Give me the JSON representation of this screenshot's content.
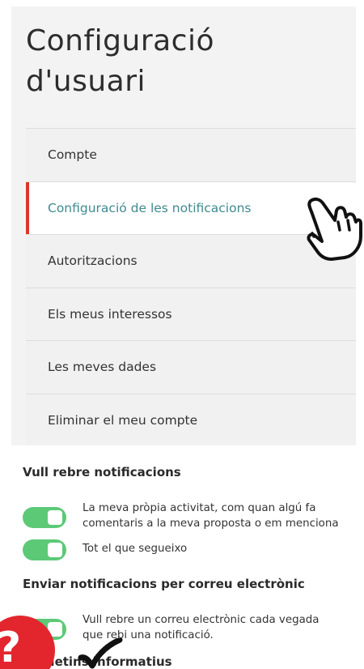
{
  "page": {
    "title": "Configuració d'usuari"
  },
  "menu": {
    "items": [
      {
        "label": "Compte"
      },
      {
        "label": "Configuració de les notificacions"
      },
      {
        "label": "Autoritzacions"
      },
      {
        "label": "Els meus interessos"
      },
      {
        "label": "Les meves dades"
      },
      {
        "label": "Eliminar el meu compte"
      }
    ],
    "active_index": 1
  },
  "notifications": {
    "heading": "Vull rebre notificacions",
    "options": [
      {
        "label": "La meva pròpia activitat, com quan algú fa comentaris a la meva proposta o em menciona",
        "enabled": true
      },
      {
        "label": "Tot el que segueixo",
        "enabled": true
      }
    ]
  },
  "email": {
    "heading": "Enviar notificacions per correu electrònic",
    "options": [
      {
        "label": "Vull rebre un correu electrònic cada vegada que rebi una notificació.",
        "enabled": true
      }
    ],
    "next_heading_partial": "Butlletins informatius"
  },
  "icons": {
    "pointer": "hand-pointer-icon",
    "help": "question-mark-icon",
    "check": "checkmark-icon"
  },
  "colors": {
    "active_text": "#3f8a8f",
    "active_marker": "#d9372c",
    "toggle_on": "#5cc977",
    "help_badge": "#e3262e"
  }
}
